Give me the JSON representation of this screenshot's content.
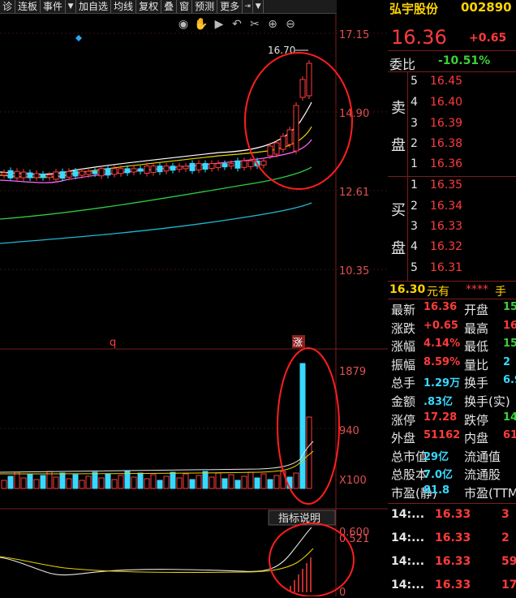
{
  "toolbar": {
    "items": [
      "诊",
      "连板",
      "事件",
      "加自选",
      "均线",
      "复权",
      "叠",
      "窗",
      "预测",
      "更多"
    ]
  },
  "icons": [
    "eye-icon",
    "hand-icon",
    "play-icon",
    "undo-icon",
    "scissors-icon",
    "zoom-in-icon",
    "zoom-out-icon"
  ],
  "chart": {
    "price_axis": [
      "17.15",
      "14.90",
      "12.61",
      "10.35"
    ],
    "peak_label": "16.70",
    "mark_q": "q",
    "mark_zhang": "涨",
    "volume_axis": [
      "1879",
      "940",
      "X100"
    ],
    "indicator_button": "指标说明",
    "indicator_axis": [
      "0.600",
      "0.521",
      "0"
    ]
  },
  "stock": {
    "name": "弘宇股份",
    "code": "002890",
    "price": "16.36",
    "change": "+0.65",
    "weibi_label": "委比",
    "weibi_value": "-10.51%"
  },
  "orderbook": {
    "sell_label_1": "卖",
    "sell_label_2": "盘",
    "buy_label_1": "买",
    "buy_label_2": "盘",
    "sell": [
      {
        "level": "5",
        "price": "16.45"
      },
      {
        "level": "4",
        "price": "16.40"
      },
      {
        "level": "3",
        "price": "16.39"
      },
      {
        "level": "2",
        "price": "16.38"
      },
      {
        "level": "1",
        "price": "16.36"
      }
    ],
    "buy": [
      {
        "level": "1",
        "price": "16.35"
      },
      {
        "level": "2",
        "price": "16.34"
      },
      {
        "level": "3",
        "price": "16.33"
      },
      {
        "level": "4",
        "price": "16.32"
      },
      {
        "level": "5",
        "price": "16.31"
      }
    ]
  },
  "notice": {
    "price": "16.30",
    "text": "元有",
    "stars": "****",
    "tail": "手"
  },
  "quote": [
    {
      "l1": "最新",
      "v1": "16.36",
      "l2": "开盘",
      "v2": "15"
    },
    {
      "l1": "涨跌",
      "v1": "+0.65",
      "l2": "最高",
      "v2": "16"
    },
    {
      "l1": "涨幅",
      "v1": "4.14%",
      "l2": "最低",
      "v2": "15"
    },
    {
      "l1": "振幅",
      "v1": "8.59%",
      "l2": "量比",
      "v2": "2"
    },
    {
      "l1": "总手",
      "v1": "1.29万",
      "l2": "换手",
      "v2": "6.9"
    },
    {
      "l1": "金额",
      "v1": ".83亿",
      "l2": "换手(实)",
      "v2": ""
    },
    {
      "l1": "涨停",
      "v1": "17.28",
      "l2": "跌停",
      "v2": "14"
    },
    {
      "l1": "外盘",
      "v1": "51162",
      "l2": "内盘",
      "v2": "61"
    },
    {
      "l1": "总市值",
      "v1": "29亿",
      "l2": "流通值",
      "v2": ""
    },
    {
      "l1": "总股本",
      "v1": "7.0亿",
      "l2": "流通股",
      "v2": ""
    },
    {
      "l1": "市盈(静)",
      "v1": "81.8",
      "l2": "市盈(TTM)",
      "v2": ""
    }
  ],
  "ticks": [
    {
      "time": "14:...",
      "price": "16.33",
      "vol": "3"
    },
    {
      "time": "14:...",
      "price": "16.33",
      "vol": "2"
    },
    {
      "time": "14:...",
      "price": "16.33",
      "vol": "59"
    },
    {
      "time": "14:...",
      "price": "16.33",
      "vol": "17"
    }
  ],
  "colors": {
    "up": "#ff3b3b",
    "down": "#38d9ff",
    "annotation": "#ff1e1e"
  }
}
